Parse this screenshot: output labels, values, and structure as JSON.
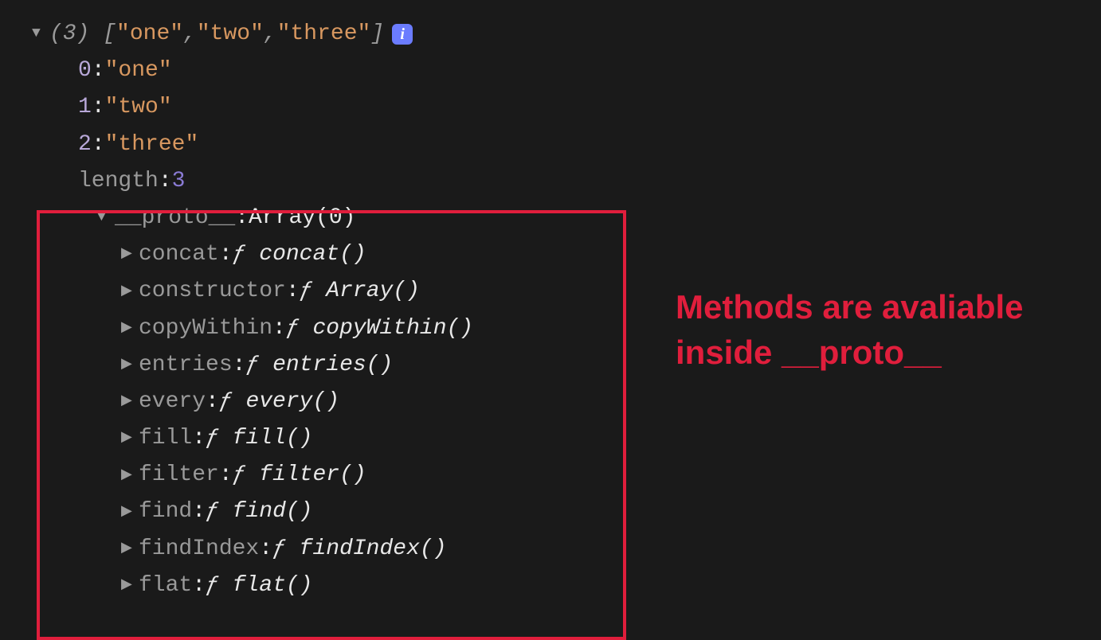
{
  "header": {
    "count": "(3)",
    "preview_open": "[",
    "items": [
      "\"one\"",
      "\"two\"",
      "\"three\""
    ],
    "sep": ", ",
    "preview_close": "]",
    "info": "i"
  },
  "elements": [
    {
      "key": "0",
      "value": "\"one\""
    },
    {
      "key": "1",
      "value": "\"two\""
    },
    {
      "key": "2",
      "value": "\"three\""
    }
  ],
  "length": {
    "key": "length",
    "value": "3"
  },
  "proto": {
    "key": "__proto__",
    "value": "Array(0)",
    "methods": [
      {
        "key": "concat",
        "fn": "concat()"
      },
      {
        "key": "constructor",
        "fn": "Array()"
      },
      {
        "key": "copyWithin",
        "fn": "copyWithin()"
      },
      {
        "key": "entries",
        "fn": "entries()"
      },
      {
        "key": "every",
        "fn": "every()"
      },
      {
        "key": "fill",
        "fn": "fill()"
      },
      {
        "key": "filter",
        "fn": "filter()"
      },
      {
        "key": "find",
        "fn": "find()"
      },
      {
        "key": "findIndex",
        "fn": "findIndex()"
      },
      {
        "key": "flat",
        "fn": "flat()"
      }
    ]
  },
  "annotation": "Methods are avaliable inside __proto__",
  "glyph_f": "ƒ"
}
